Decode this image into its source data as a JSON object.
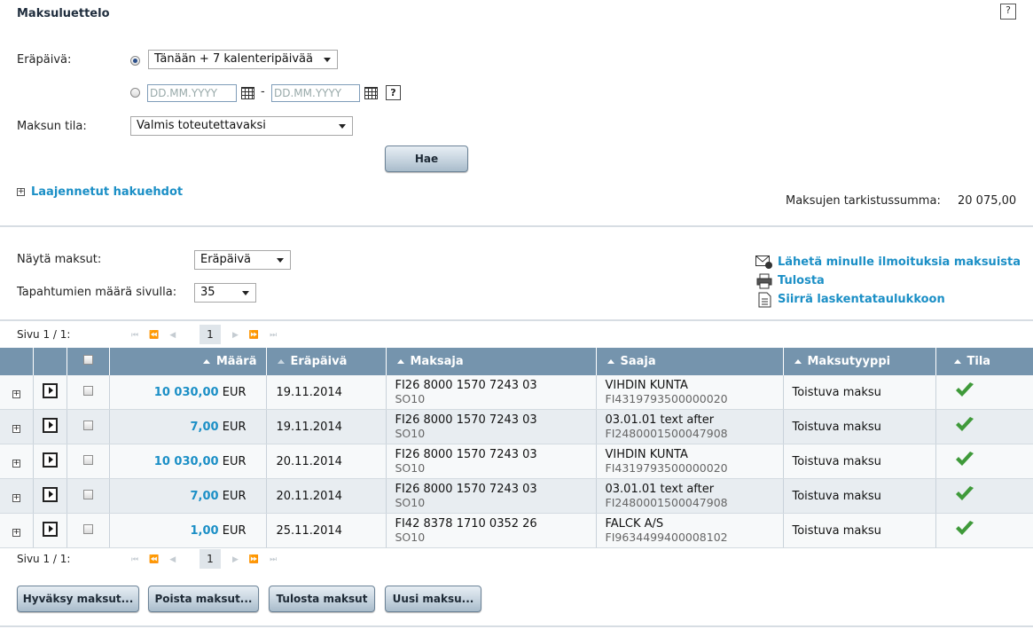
{
  "title": "Maksuluettelo",
  "search": {
    "due_label": "Eräpäivä:",
    "due_select": "Tänään + 7 kalenteripäivää",
    "date_from_placeholder": "DD.MM.YYYY",
    "date_to_placeholder": "DD.MM.YYYY",
    "date_separator": "-",
    "status_label": "Maksun tila:",
    "status_select": "Valmis toteutettavaksi",
    "search_button": "Hae",
    "advanced_link": "Laajennetut hakuehdot",
    "checksum_label": "Maksujen tarkistussumma:",
    "checksum_value": "20 075,00"
  },
  "display": {
    "show_label": "Näytä maksut:",
    "show_select": "Eräpäivä",
    "per_page_label": "Tapahtumien määrä sivulla:",
    "per_page_select": "35"
  },
  "actions": {
    "notify": "Lähetä minulle ilmoituksia maksuista",
    "print": "Tulosta",
    "export": "Siirrä laskentataulukkoon"
  },
  "pager": {
    "label": "Sivu 1 / 1:",
    "current": "1"
  },
  "table": {
    "headers": {
      "amount": "Määrä",
      "due": "Eräpäivä",
      "payer": "Maksaja",
      "payee": "Saaja",
      "type": "Maksutyyppi",
      "status": "Tila"
    },
    "rows": [
      {
        "amount": "10 030,00",
        "currency": "EUR",
        "due": "19.11.2014",
        "payer": "FI26 8000 1570 7243 03",
        "payer_sub": "SO10",
        "payee": "VIHDIN KUNTA",
        "payee_sub": "FI4319793500000020",
        "type": "Toistuva maksu"
      },
      {
        "amount": "7,00",
        "currency": "EUR",
        "due": "19.11.2014",
        "payer": "FI26 8000 1570 7243 03",
        "payer_sub": "SO10",
        "payee": "03.01.01 text after",
        "payee_sub": "FI2480001500047908",
        "type": "Toistuva maksu"
      },
      {
        "amount": "10 030,00",
        "currency": "EUR",
        "due": "20.11.2014",
        "payer": "FI26 8000 1570 7243 03",
        "payer_sub": "SO10",
        "payee": "VIHDIN KUNTA",
        "payee_sub": "FI4319793500000020",
        "type": "Toistuva maksu"
      },
      {
        "amount": "7,00",
        "currency": "EUR",
        "due": "20.11.2014",
        "payer": "FI26 8000 1570 7243 03",
        "payer_sub": "SO10",
        "payee": "03.01.01 text after",
        "payee_sub": "FI2480001500047908",
        "type": "Toistuva maksu"
      },
      {
        "amount": "1,00",
        "currency": "EUR",
        "due": "25.11.2014",
        "payer": "FI42 8378 1710 0352 26",
        "payer_sub": "SO10",
        "payee": "FALCK A/S",
        "payee_sub": "FI9634499400008102",
        "type": "Toistuva maksu"
      }
    ]
  },
  "buttons": {
    "approve": "Hyväksy maksut...",
    "delete": "Poista maksut...",
    "print": "Tulosta maksut",
    "new": "Uusi maksu..."
  },
  "colors": {
    "accent_link": "#1b8fc6",
    "header_bg": "#7594ad",
    "check_green": "#3f9a3a"
  }
}
